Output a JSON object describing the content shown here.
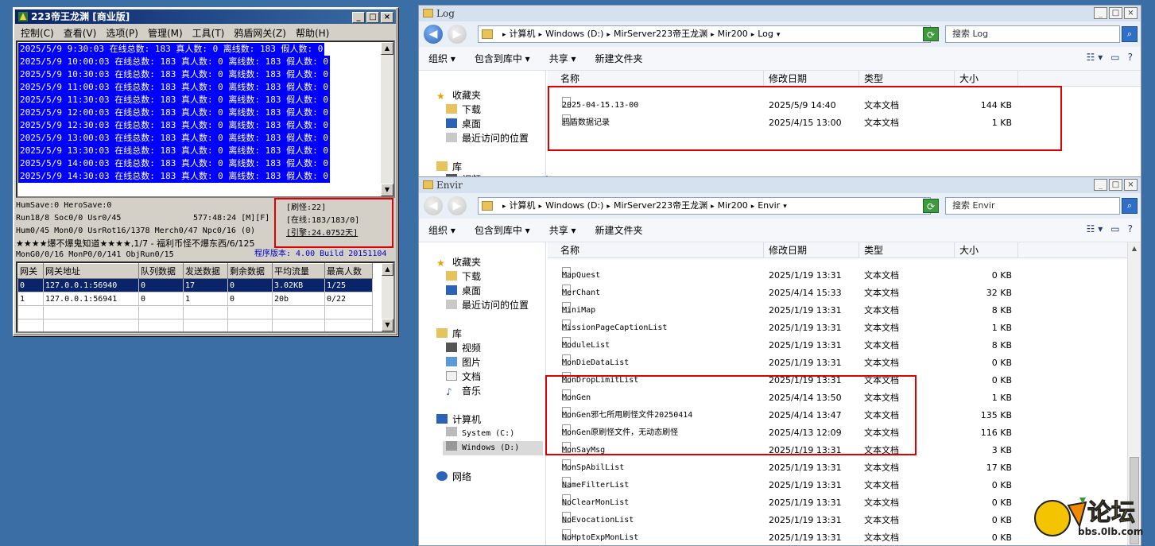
{
  "server": {
    "title": "223帝王龙渊 [商业版]",
    "menu": [
      "控制(C)",
      "查看(V)",
      "选项(P)",
      "管理(M)",
      "工具(T)",
      "鸦盾网关(Z)",
      "帮助(H)"
    ],
    "log_lines": [
      "2025/5/9 9:30:03 在线总数: 183 真人数: 0 离线数: 183 假人数: 0",
      "2025/5/9 10:00:03 在线总数: 183 真人数: 0 离线数: 183 假人数: 0",
      "2025/5/9 10:30:03 在线总数: 183 真人数: 0 离线数: 183 假人数: 0",
      "2025/5/9 11:00:03 在线总数: 183 真人数: 0 离线数: 183 假人数: 0",
      "2025/5/9 11:30:03 在线总数: 183 真人数: 0 离线数: 183 假人数: 0",
      "2025/5/9 12:00:03 在线总数: 183 真人数: 0 离线数: 183 假人数: 0",
      "2025/5/9 12:30:03 在线总数: 183 真人数: 0 离线数: 183 假人数: 0",
      "2025/5/9 13:00:03 在线总数: 183 真人数: 0 离线数: 183 假人数: 0",
      "2025/5/9 13:30:03 在线总数: 183 真人数: 0 离线数: 183 假人数: 0",
      "2025/5/9 14:00:03 在线总数: 183 真人数: 0 离线数: 183 假人数: 0",
      "2025/5/9 14:30:03 在线总数: 183 真人数: 0 离线数: 183 假人数: 0"
    ],
    "stats": {
      "save": "HumSave:0 HeroSave:0",
      "run": "Run18/8 Soc0/0 Usr0/45",
      "uptime": "577:48:24 [M][F]",
      "hum": "Hum0/45 Mon0/0 UsrRot16/1378 Merch0/47 Npc0/16 (0)",
      "marquee": "★★★★爆不爆鬼知道★★★★,1/7 - 福利币怪不爆东西/6/125",
      "mongen": "MonG0/0/16 MonP0/0/141 ObjRun0/15",
      "version": "程序版本: 4.00 Build 20151104"
    },
    "info_box": [
      "[刷怪:22]",
      "[在线:183/183/0]",
      "[引擎:24.0752天]"
    ],
    "gate_columns": [
      "网关",
      "网关地址",
      "队列数据",
      "发送数据",
      "剩余数据",
      "平均流量",
      "最高人数"
    ],
    "gate_rows": [
      [
        "0",
        "127.0.0.1:56940",
        "0",
        "17",
        "0",
        "3.02KB",
        "1/25"
      ],
      [
        "1",
        "127.0.0.1:56941",
        "0",
        "1",
        "0",
        "20b",
        "0/22"
      ]
    ]
  },
  "log_window": {
    "title": "Log",
    "path": [
      "计算机",
      "Windows (D:)",
      "MirServer223帝王龙渊",
      "Mir200",
      "Log"
    ],
    "search": "搜索 Log",
    "commands": [
      "组织 ▾",
      "包含到库中 ▾",
      "共享 ▾",
      "新建文件夹"
    ],
    "nav": {
      "favorites": "收藏夹",
      "downloads": "下载",
      "desktop": "桌面",
      "recent": "最近访问的位置",
      "library": "库",
      "video": "视频"
    },
    "columns": [
      "名称",
      "修改日期",
      "类型",
      "大小"
    ],
    "files": [
      {
        "name": "2025-04-15.13-00",
        "date": "2025/5/9 14:40",
        "type": "文本文档",
        "size": "144 KB"
      },
      {
        "name": "鸦盾数据记录",
        "date": "2025/4/15 13:00",
        "type": "文本文档",
        "size": "1 KB"
      }
    ]
  },
  "envir_window": {
    "title": "Envir",
    "path": [
      "计算机",
      "Windows (D:)",
      "MirServer223帝王龙渊",
      "Mir200",
      "Envir"
    ],
    "search": "搜索 Envir",
    "commands": [
      "组织 ▾",
      "包含到库中 ▾",
      "共享 ▾",
      "新建文件夹"
    ],
    "nav": {
      "favorites": "收藏夹",
      "downloads": "下载",
      "desktop": "桌面",
      "recent": "最近访问的位置",
      "library": "库",
      "video": "视频",
      "pictures": "图片",
      "documents": "文档",
      "music": "音乐",
      "computer": "计算机",
      "drive_c": "System (C:)",
      "drive_d": "Windows (D:)",
      "network": "网络"
    },
    "columns": [
      "名称",
      "修改日期",
      "类型",
      "大小"
    ],
    "files": [
      {
        "name": "MapQuest",
        "date": "2025/1/19 13:31",
        "type": "文本文档",
        "size": "0 KB"
      },
      {
        "name": "MerChant",
        "date": "2025/4/14 15:33",
        "type": "文本文档",
        "size": "32 KB"
      },
      {
        "name": "MiniMap",
        "date": "2025/1/19 13:31",
        "type": "文本文档",
        "size": "8 KB"
      },
      {
        "name": "MissionPageCaptionList",
        "date": "2025/1/19 13:31",
        "type": "文本文档",
        "size": "1 KB"
      },
      {
        "name": "ModuleList",
        "date": "2025/1/19 13:31",
        "type": "文本文档",
        "size": "8 KB"
      },
      {
        "name": "MonDieDataList",
        "date": "2025/1/19 13:31",
        "type": "文本文档",
        "size": "0 KB"
      },
      {
        "name": "MonDropLimitList",
        "date": "2025/1/19 13:31",
        "type": "文本文档",
        "size": "0 KB"
      },
      {
        "name": "MonGen",
        "date": "2025/4/14 13:50",
        "type": "文本文档",
        "size": "1 KB"
      },
      {
        "name": "MonGen邪七所用刷怪文件20250414",
        "date": "2025/4/14 13:47",
        "type": "文本文档",
        "size": "135 KB"
      },
      {
        "name": "MonGen原刷怪文件，无动态刷怪",
        "date": "2025/4/13 12:09",
        "type": "文本文档",
        "size": "116 KB"
      },
      {
        "name": "MonSayMsg",
        "date": "2025/1/19 13:31",
        "type": "文本文档",
        "size": "3 KB"
      },
      {
        "name": "MonSpAbilList",
        "date": "2025/1/19 13:31",
        "type": "文本文档",
        "size": "17 KB"
      },
      {
        "name": "NameFilterList",
        "date": "2025/1/19 13:31",
        "type": "文本文档",
        "size": "0 KB"
      },
      {
        "name": "NoClearMonList",
        "date": "2025/1/19 13:31",
        "type": "文本文档",
        "size": "0 KB"
      },
      {
        "name": "NoEvocationList",
        "date": "2025/1/19 13:31",
        "type": "文本文档",
        "size": "0 KB"
      },
      {
        "name": "NoHptoExpMonList",
        "date": "2025/1/19 13:31",
        "type": "文本文档",
        "size": "0 KB"
      }
    ]
  },
  "watermark": {
    "text": "论坛",
    "url": "bbs.0lb.com"
  },
  "colors": {
    "selection": "#0000ff",
    "highlight_box": "#e00000",
    "desktop": "#3a6ea5"
  }
}
